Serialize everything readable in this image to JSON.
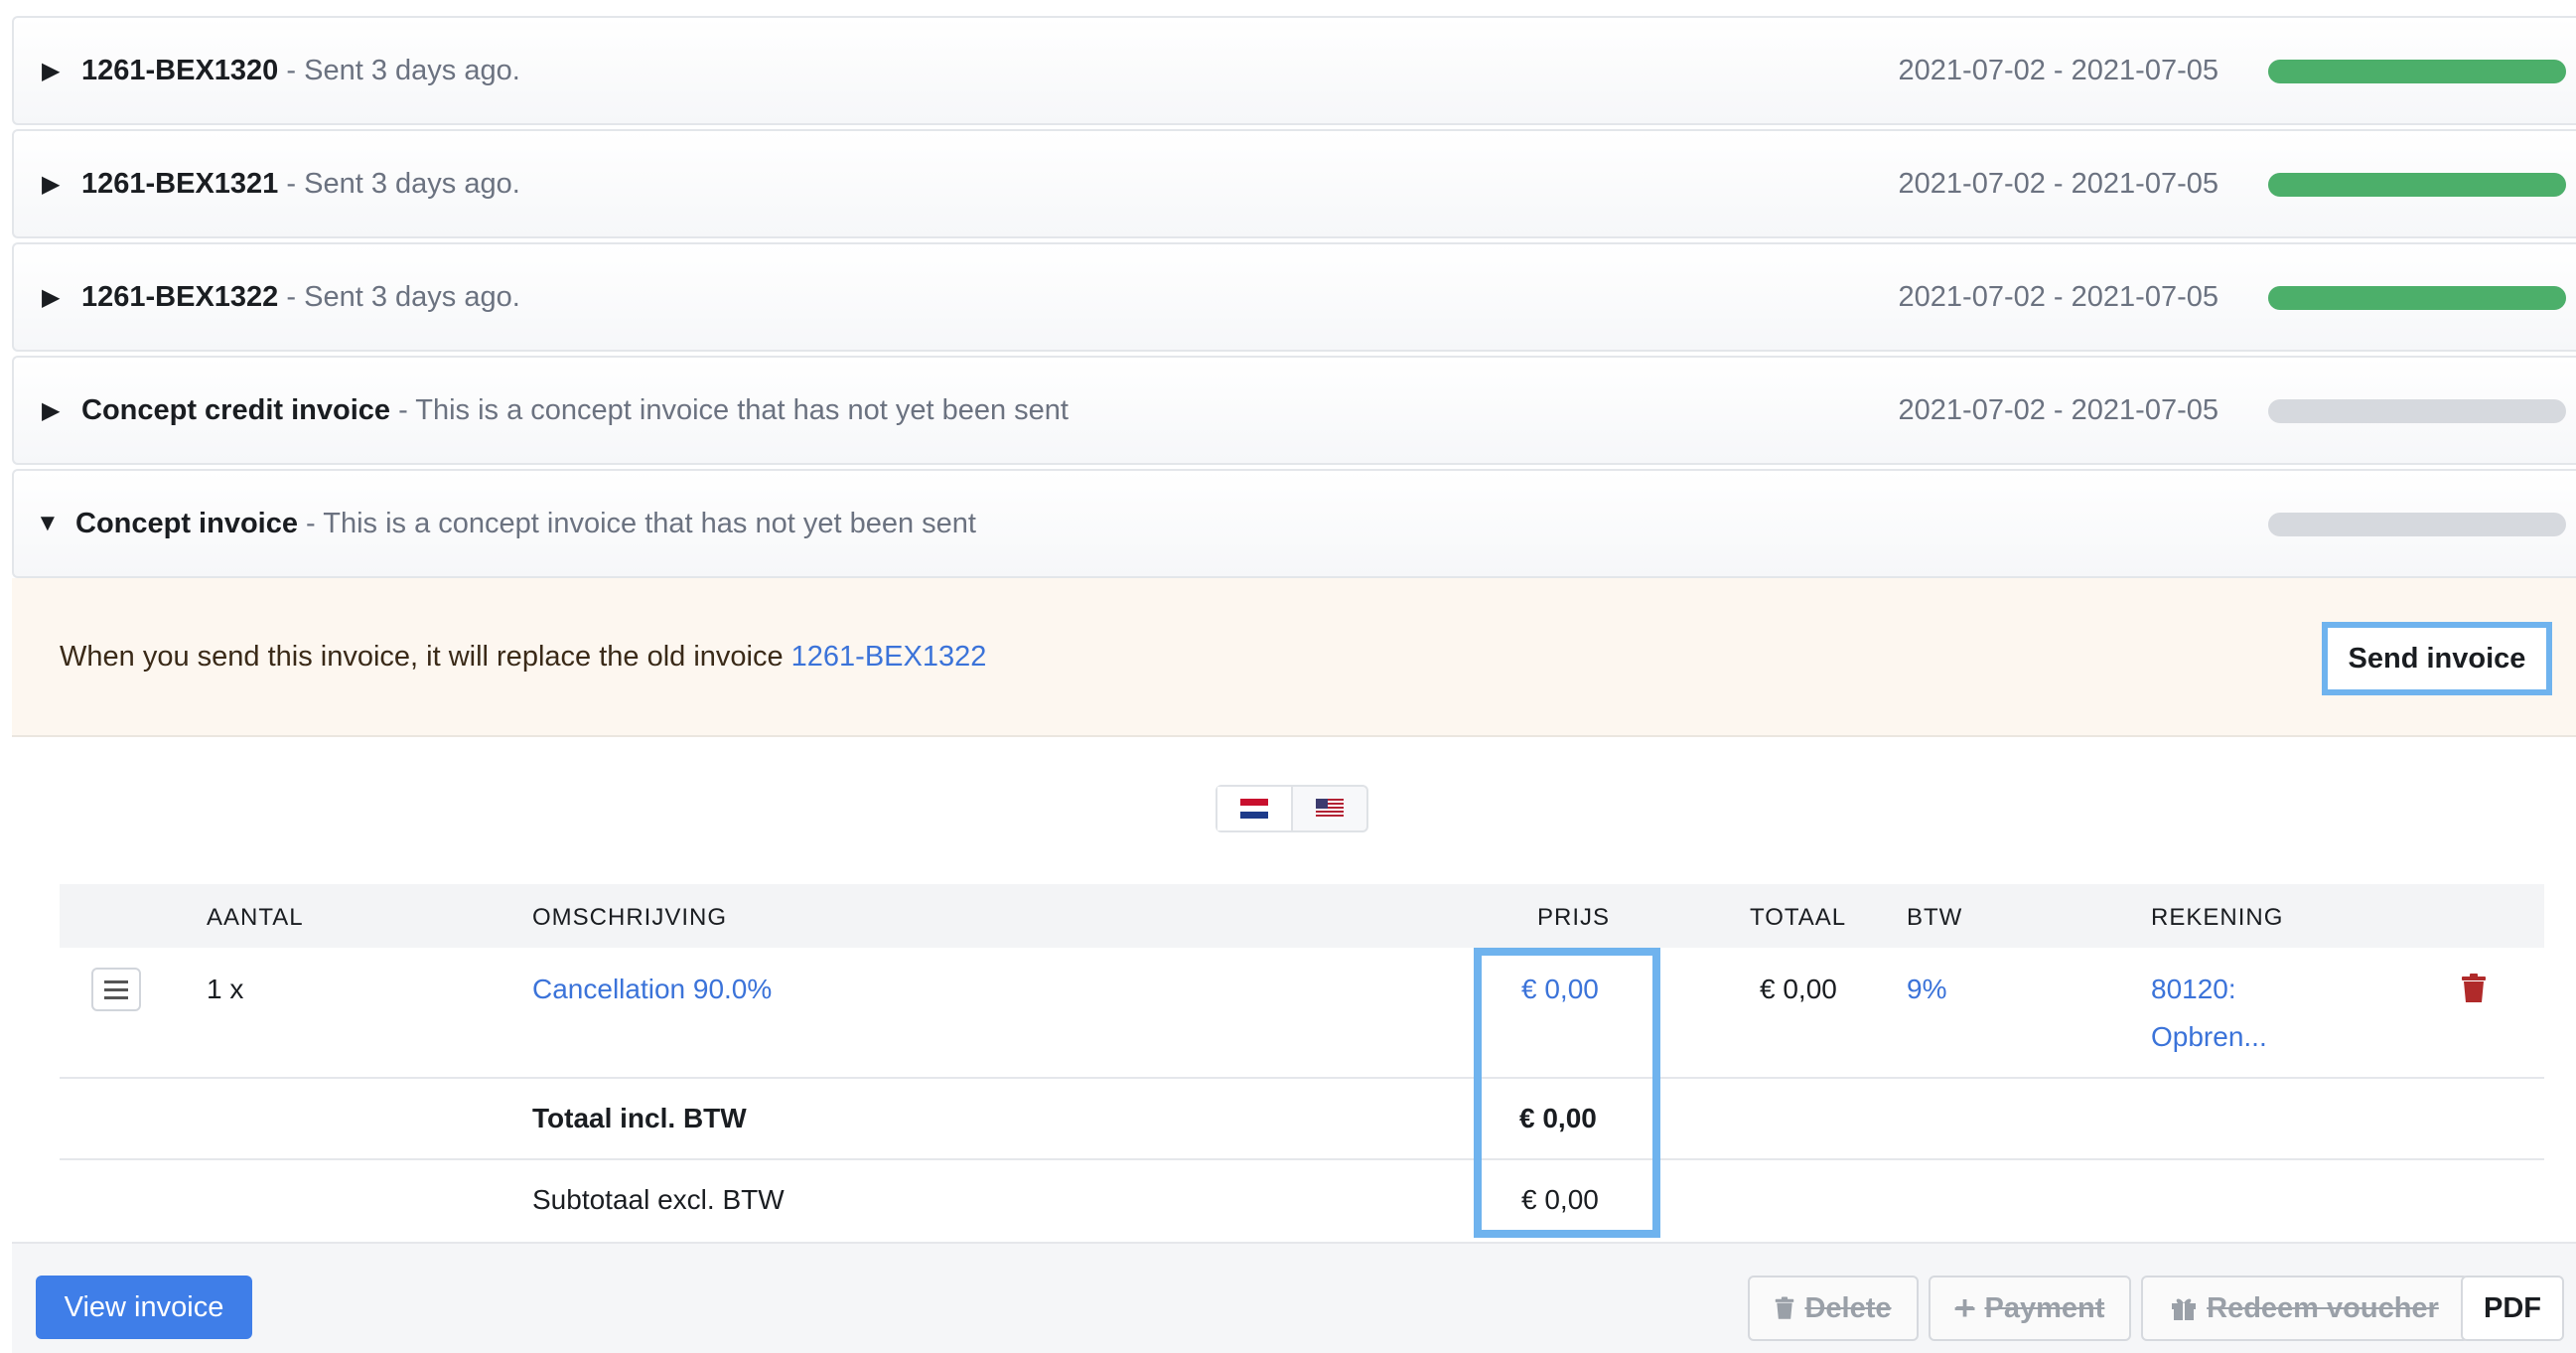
{
  "invoices": [
    {
      "name": "1261-BEX1320",
      "sub": " - Sent 3 days ago.",
      "dates": "2021-07-02 - 2021-07-05",
      "progress": 1.0,
      "toggle": "▶"
    },
    {
      "name": "1261-BEX1321",
      "sub": " - Sent 3 days ago.",
      "dates": "2021-07-02 - 2021-07-05",
      "progress": 1.0,
      "toggle": "▶"
    },
    {
      "name": "1261-BEX1322",
      "sub": " - Sent 3 days ago.",
      "dates": "2021-07-02 - 2021-07-05",
      "progress": 1.0,
      "toggle": "▶"
    },
    {
      "name": "Concept credit invoice",
      "sub": " - This is a concept invoice that has not yet been sent",
      "dates": "2021-07-02 - 2021-07-05",
      "progress": 0,
      "toggle": "▶"
    },
    {
      "name": "Concept invoice",
      "sub": " - This is a concept invoice that has not yet been sent",
      "dates": "",
      "progress": 0,
      "toggle": "▼"
    }
  ],
  "notice": {
    "text": "When you send this invoice, it will replace the old invoice ",
    "link": "1261-BEX1322",
    "send_label": "Send invoice"
  },
  "table": {
    "headers": {
      "aantal": "AANTAL",
      "omschrijving": "OMSCHRIJVING",
      "prijs": "PRIJS",
      "totaal": "TOTAAL",
      "btw": "BTW",
      "rekening": "REKENING"
    },
    "line": {
      "aantal": "1 x",
      "omschrijving": "Cancellation 90.0%",
      "prijs": "€ 0,00",
      "totaal": "€ 0,00",
      "btw": "9%",
      "rekening_1": "80120:",
      "rekening_2": "Opbren..."
    },
    "total_incl": {
      "label": "Totaal incl. BTW",
      "value": "€ 0,00"
    },
    "subtotal_excl": {
      "label": "Subtotaal excl. BTW",
      "value": "€ 0,00"
    }
  },
  "footer": {
    "view_label": "View invoice",
    "delete_label": "Delete",
    "payment_label": "Payment",
    "voucher_label": "Redeem voucher",
    "pdf_label": "PDF"
  },
  "colors": {
    "accent": "#3f7ee8",
    "highlight": "#6fb3ee",
    "progress_done": "#4caf6a",
    "progress_empty": "#d6d9de",
    "danger": "#b02a2a"
  }
}
